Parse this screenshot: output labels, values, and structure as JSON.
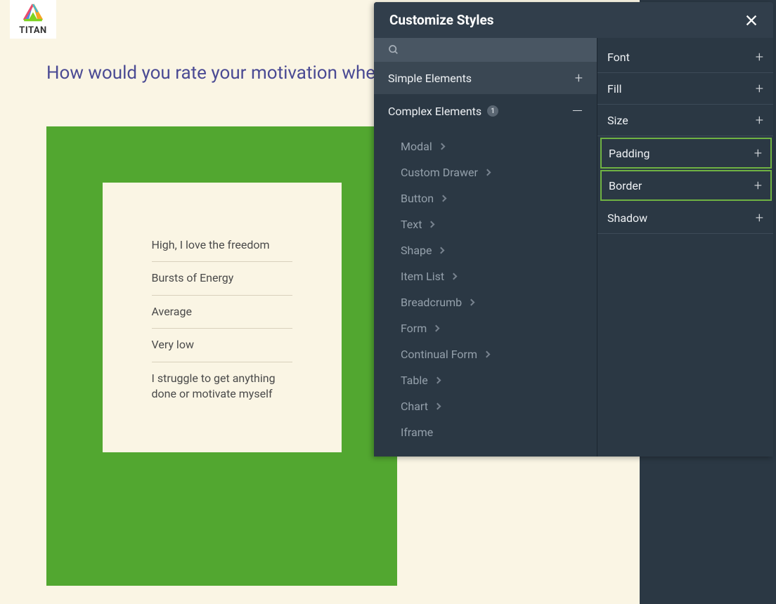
{
  "logo": {
    "text": "TITAN"
  },
  "question": "How would you rate your motivation when home?",
  "options": [
    "High, I love the freedom",
    "Bursts of Energy",
    "Average",
    "Very low",
    "I struggle to get anything done or motivate myself"
  ],
  "panel": {
    "title": "Customize Styles",
    "sections": {
      "simple": {
        "label": "Simple Elements"
      },
      "complex": {
        "label": "Complex Elements",
        "badge": "1",
        "items": [
          "Modal",
          "Custom Drawer",
          "Button",
          "Text",
          "Shape",
          "Item List",
          "Breadcrumb",
          "Form",
          "Continual Form",
          "Table",
          "Chart",
          "Iframe"
        ]
      }
    },
    "styleRows": [
      {
        "label": "Font",
        "highlighted": false
      },
      {
        "label": "Fill",
        "highlighted": false
      },
      {
        "label": "Size",
        "highlighted": false
      },
      {
        "label": "Padding",
        "highlighted": true
      },
      {
        "label": "Border",
        "highlighted": true
      },
      {
        "label": "Shadow",
        "highlighted": false
      }
    ]
  }
}
